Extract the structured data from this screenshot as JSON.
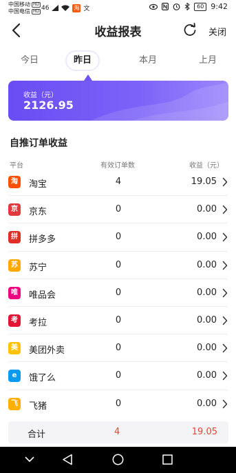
{
  "status_bar": {
    "carrier1": "中国移动",
    "carrier2": "中国电信",
    "hd": "HD",
    "signal_text": "46",
    "taobao_mini": "淘",
    "wen": "文",
    "battery": "60",
    "time": "9:42"
  },
  "nav": {
    "title": "收益报表",
    "close_label": "关闭"
  },
  "tabs": [
    {
      "label": "今日",
      "active": false
    },
    {
      "label": "昨日",
      "active": true
    },
    {
      "label": "本月",
      "active": false
    },
    {
      "label": "上月",
      "active": false
    }
  ],
  "summary": {
    "label": "收益（元）",
    "value": "2126.95",
    "color_start": "#6a4df4",
    "color_end": "#9b86fb"
  },
  "section_title": "自推订单收益",
  "columns": {
    "platform": "平台",
    "orders": "有效订单数",
    "income": "收益（元）"
  },
  "rows": [
    {
      "icon": "taobao-icon",
      "glyph": "淘",
      "color": "#ff5000",
      "name": "淘宝",
      "orders": "4",
      "income": "19.05"
    },
    {
      "icon": "jd-icon",
      "glyph": "京",
      "color": "#e4393c",
      "name": "京东",
      "orders": "0",
      "income": "0.00"
    },
    {
      "icon": "pinduoduo-icon",
      "glyph": "拼",
      "color": "#e02e24",
      "name": "拼多多",
      "orders": "0",
      "income": "0.00"
    },
    {
      "icon": "suning-icon",
      "glyph": "苏",
      "color": "#ffaa00",
      "name": "苏宁",
      "orders": "0",
      "income": "0.00"
    },
    {
      "icon": "vip-icon",
      "glyph": "唯",
      "color": "#f10180",
      "name": "唯品会",
      "orders": "0",
      "income": "0.00"
    },
    {
      "icon": "kaola-icon",
      "glyph": "考",
      "color": "#e31436",
      "name": "考拉",
      "orders": "0",
      "income": "0.00"
    },
    {
      "icon": "meituan-icon",
      "glyph": "美",
      "color": "#ffc300",
      "name": "美团外卖",
      "orders": "0",
      "income": "0.00"
    },
    {
      "icon": "eleme-icon",
      "glyph": "e",
      "color": "#0a9bf0",
      "name": "饿了么",
      "orders": "0",
      "income": "0.00"
    },
    {
      "icon": "fliggy-icon",
      "glyph": "飞",
      "color": "#ffb000",
      "name": "飞猪",
      "orders": "0",
      "income": "0.00"
    }
  ],
  "total": {
    "label": "合计",
    "orders": "4",
    "income": "19.05",
    "color": "#e8423a"
  }
}
